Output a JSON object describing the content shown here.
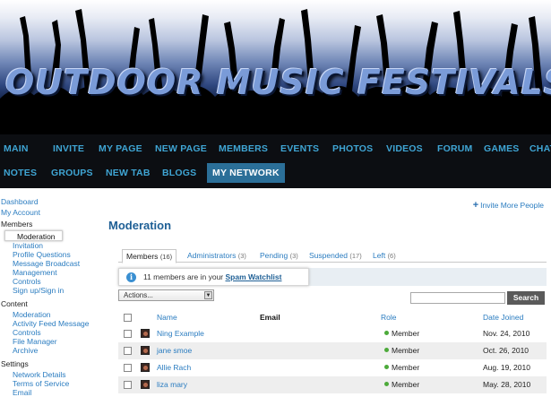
{
  "site": {
    "title": "OUTDOOR MUSIC FESTIVALS"
  },
  "nav": {
    "row1": [
      "MAIN",
      "INVITE",
      "MY PAGE",
      "NEW PAGE",
      "MEMBERS",
      "EVENTS",
      "PHOTOS",
      "VIDEOS",
      "FORUM",
      "GAMES",
      "CHAT"
    ],
    "row2": [
      "NOTES",
      "GROUPS",
      "NEW TAB",
      "BLOGS",
      "MY NETWORK"
    ],
    "active": "MY NETWORK"
  },
  "sidebar": {
    "dashboard": "Dashboard",
    "my_account": "My Account",
    "members_heading": "Members",
    "members_items": [
      "Moderation",
      "Invitation",
      "Profile Questions",
      "Message Broadcast",
      "Management",
      "Controls",
      "Sign up/Sign in"
    ],
    "content_heading": "Content",
    "content_items": [
      "Moderation",
      "Activity Feed Message",
      "Controls",
      "File Manager",
      "Archive"
    ],
    "settings_heading": "Settings",
    "settings_items": [
      "Network Details",
      "Terms of Service",
      "Email"
    ]
  },
  "page": {
    "title": "Moderation",
    "invite_link": "Invite More People"
  },
  "tabs": [
    {
      "label": "Members",
      "count": "(16)"
    },
    {
      "label": "Administrators",
      "count": "(3)"
    },
    {
      "label": "Pending",
      "count": "(3)"
    },
    {
      "label": "Suspended",
      "count": "(17)"
    },
    {
      "label": "Left",
      "count": "(6)"
    }
  ],
  "notice": {
    "text": "11 members are in your ",
    "link": "Spam Watchlist"
  },
  "actions_select": {
    "value": "Actions..."
  },
  "search": {
    "button": "Search",
    "value": ""
  },
  "table": {
    "headers": {
      "name": "Name",
      "email": "Email",
      "role": "Role",
      "date": "Date Joined"
    },
    "rows": [
      {
        "name": "Ning Example",
        "role": "Member",
        "date": "Nov. 24, 2010"
      },
      {
        "name": "jane smoe",
        "role": "Member",
        "date": "Oct. 26, 2010"
      },
      {
        "name": "Allie Rach",
        "role": "Member",
        "date": "Aug. 19, 2010"
      },
      {
        "name": "liza mary",
        "role": "Member",
        "date": "May. 28, 2010"
      }
    ]
  },
  "colors": {
    "nav_bg": "#0c0e12",
    "nav_link": "#3fa5d4",
    "nav_active_bg": "#2b6f98",
    "link": "#2a7cc0",
    "title": "#1e5f95"
  },
  "icons": [
    "plus-icon",
    "info-icon",
    "dropdown-arrow-icon",
    "status-dot-icon"
  ]
}
